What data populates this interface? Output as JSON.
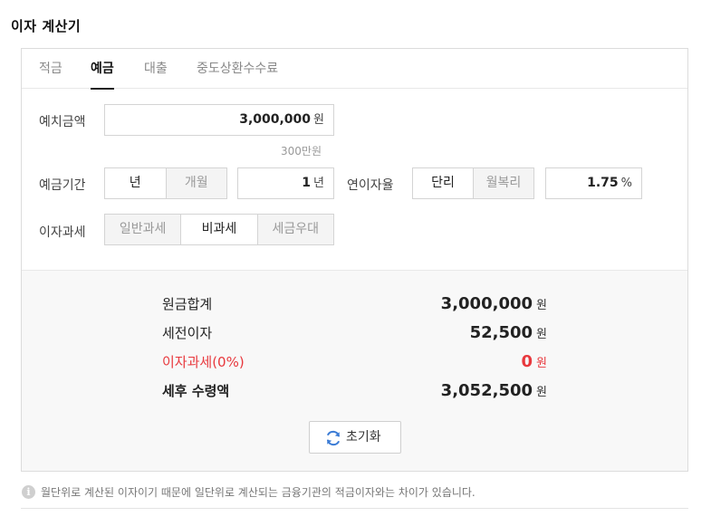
{
  "title": "이자 계산기",
  "tabs": [
    {
      "label": "적금",
      "active": false
    },
    {
      "label": "예금",
      "active": true
    },
    {
      "label": "대출",
      "active": false
    },
    {
      "label": "중도상환수수료",
      "active": false
    }
  ],
  "deposit": {
    "label": "예치금액",
    "value": "3,000,000",
    "unit": "원",
    "hint": "300만원"
  },
  "period": {
    "label": "예금기간",
    "options": [
      "년",
      "개월"
    ],
    "selected": "년",
    "value": "1",
    "unit": "년"
  },
  "rate": {
    "label": "연이자율",
    "options": [
      "단리",
      "월복리"
    ],
    "selected": "단리",
    "value": "1.75",
    "unit": "%"
  },
  "tax": {
    "label": "이자과세",
    "options": [
      "일반과세",
      "비과세",
      "세금우대"
    ],
    "selected": "비과세"
  },
  "results": {
    "principal": {
      "label": "원금합계",
      "value": "3,000,000",
      "unit": "원"
    },
    "interest": {
      "label": "세전이자",
      "value": "52,500",
      "unit": "원"
    },
    "tax": {
      "label": "이자과세(0%)",
      "value": "0",
      "unit": "원"
    },
    "net": {
      "label": "세후 수령액",
      "value": "3,052,500",
      "unit": "원"
    }
  },
  "reset_label": "초기화",
  "notice": "월단위로 계산된 이자이기 때문에 일단위로 계산되는 금융기관의 적금이자와는 차이가 있습니다.",
  "colors": {
    "accent_red": "#e8383d",
    "refresh_blue": "#3a7bd5"
  },
  "icons": {
    "reset": "refresh-icon",
    "notice": "info-icon"
  }
}
